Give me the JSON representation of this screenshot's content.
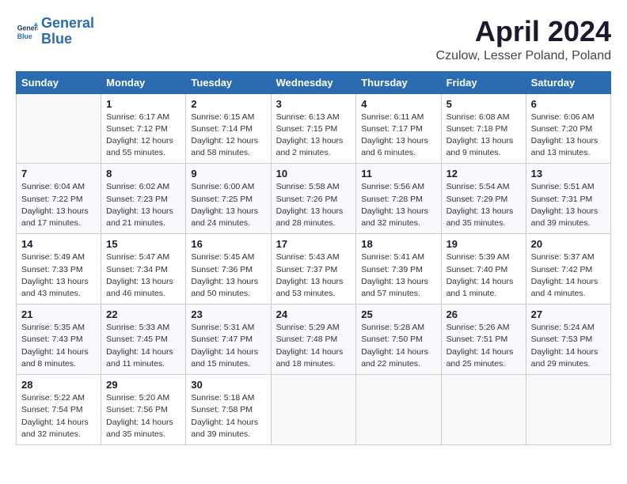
{
  "logo": {
    "line1": "General",
    "line2": "Blue"
  },
  "title": "April 2024",
  "location": "Czulow, Lesser Poland, Poland",
  "weekdays": [
    "Sunday",
    "Monday",
    "Tuesday",
    "Wednesday",
    "Thursday",
    "Friday",
    "Saturday"
  ],
  "weeks": [
    [
      {
        "day": "",
        "info": ""
      },
      {
        "day": "1",
        "info": "Sunrise: 6:17 AM\nSunset: 7:12 PM\nDaylight: 12 hours\nand 55 minutes."
      },
      {
        "day": "2",
        "info": "Sunrise: 6:15 AM\nSunset: 7:14 PM\nDaylight: 12 hours\nand 58 minutes."
      },
      {
        "day": "3",
        "info": "Sunrise: 6:13 AM\nSunset: 7:15 PM\nDaylight: 13 hours\nand 2 minutes."
      },
      {
        "day": "4",
        "info": "Sunrise: 6:11 AM\nSunset: 7:17 PM\nDaylight: 13 hours\nand 6 minutes."
      },
      {
        "day": "5",
        "info": "Sunrise: 6:08 AM\nSunset: 7:18 PM\nDaylight: 13 hours\nand 9 minutes."
      },
      {
        "day": "6",
        "info": "Sunrise: 6:06 AM\nSunset: 7:20 PM\nDaylight: 13 hours\nand 13 minutes."
      }
    ],
    [
      {
        "day": "7",
        "info": "Sunrise: 6:04 AM\nSunset: 7:22 PM\nDaylight: 13 hours\nand 17 minutes."
      },
      {
        "day": "8",
        "info": "Sunrise: 6:02 AM\nSunset: 7:23 PM\nDaylight: 13 hours\nand 21 minutes."
      },
      {
        "day": "9",
        "info": "Sunrise: 6:00 AM\nSunset: 7:25 PM\nDaylight: 13 hours\nand 24 minutes."
      },
      {
        "day": "10",
        "info": "Sunrise: 5:58 AM\nSunset: 7:26 PM\nDaylight: 13 hours\nand 28 minutes."
      },
      {
        "day": "11",
        "info": "Sunrise: 5:56 AM\nSunset: 7:28 PM\nDaylight: 13 hours\nand 32 minutes."
      },
      {
        "day": "12",
        "info": "Sunrise: 5:54 AM\nSunset: 7:29 PM\nDaylight: 13 hours\nand 35 minutes."
      },
      {
        "day": "13",
        "info": "Sunrise: 5:51 AM\nSunset: 7:31 PM\nDaylight: 13 hours\nand 39 minutes."
      }
    ],
    [
      {
        "day": "14",
        "info": "Sunrise: 5:49 AM\nSunset: 7:33 PM\nDaylight: 13 hours\nand 43 minutes."
      },
      {
        "day": "15",
        "info": "Sunrise: 5:47 AM\nSunset: 7:34 PM\nDaylight: 13 hours\nand 46 minutes."
      },
      {
        "day": "16",
        "info": "Sunrise: 5:45 AM\nSunset: 7:36 PM\nDaylight: 13 hours\nand 50 minutes."
      },
      {
        "day": "17",
        "info": "Sunrise: 5:43 AM\nSunset: 7:37 PM\nDaylight: 13 hours\nand 53 minutes."
      },
      {
        "day": "18",
        "info": "Sunrise: 5:41 AM\nSunset: 7:39 PM\nDaylight: 13 hours\nand 57 minutes."
      },
      {
        "day": "19",
        "info": "Sunrise: 5:39 AM\nSunset: 7:40 PM\nDaylight: 14 hours\nand 1 minute."
      },
      {
        "day": "20",
        "info": "Sunrise: 5:37 AM\nSunset: 7:42 PM\nDaylight: 14 hours\nand 4 minutes."
      }
    ],
    [
      {
        "day": "21",
        "info": "Sunrise: 5:35 AM\nSunset: 7:43 PM\nDaylight: 14 hours\nand 8 minutes."
      },
      {
        "day": "22",
        "info": "Sunrise: 5:33 AM\nSunset: 7:45 PM\nDaylight: 14 hours\nand 11 minutes."
      },
      {
        "day": "23",
        "info": "Sunrise: 5:31 AM\nSunset: 7:47 PM\nDaylight: 14 hours\nand 15 minutes."
      },
      {
        "day": "24",
        "info": "Sunrise: 5:29 AM\nSunset: 7:48 PM\nDaylight: 14 hours\nand 18 minutes."
      },
      {
        "day": "25",
        "info": "Sunrise: 5:28 AM\nSunset: 7:50 PM\nDaylight: 14 hours\nand 22 minutes."
      },
      {
        "day": "26",
        "info": "Sunrise: 5:26 AM\nSunset: 7:51 PM\nDaylight: 14 hours\nand 25 minutes."
      },
      {
        "day": "27",
        "info": "Sunrise: 5:24 AM\nSunset: 7:53 PM\nDaylight: 14 hours\nand 29 minutes."
      }
    ],
    [
      {
        "day": "28",
        "info": "Sunrise: 5:22 AM\nSunset: 7:54 PM\nDaylight: 14 hours\nand 32 minutes."
      },
      {
        "day": "29",
        "info": "Sunrise: 5:20 AM\nSunset: 7:56 PM\nDaylight: 14 hours\nand 35 minutes."
      },
      {
        "day": "30",
        "info": "Sunrise: 5:18 AM\nSunset: 7:58 PM\nDaylight: 14 hours\nand 39 minutes."
      },
      {
        "day": "",
        "info": ""
      },
      {
        "day": "",
        "info": ""
      },
      {
        "day": "",
        "info": ""
      },
      {
        "day": "",
        "info": ""
      }
    ]
  ]
}
